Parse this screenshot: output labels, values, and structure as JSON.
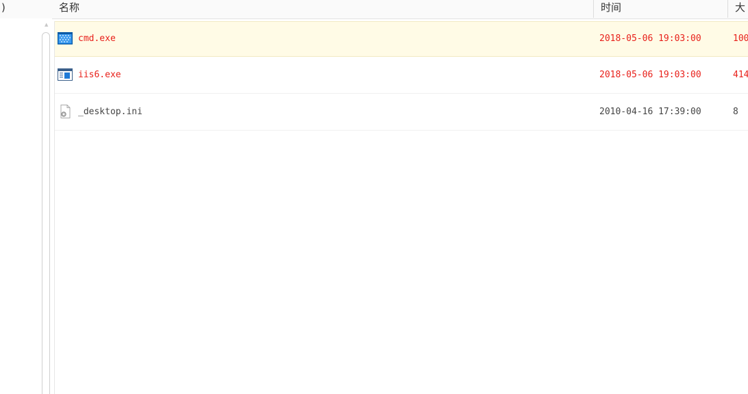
{
  "header": {
    "left_fragment": ")",
    "name_label": "名称",
    "time_label": "时间",
    "size_label_partial": "大"
  },
  "colors": {
    "highlight_text": "#e8201a",
    "normal_text": "#444444",
    "selected_row_bg": "#fffbe6"
  },
  "files": [
    {
      "name": "cmd.exe",
      "time": "2018-05-06 19:03:00",
      "size_partial": "100",
      "icon": "exe-icon",
      "highlighted": true,
      "selected": true
    },
    {
      "name": "iis6.exe",
      "time": "2018-05-06 19:03:00",
      "size_partial": "414",
      "icon": "exe-window-icon",
      "highlighted": true,
      "selected": false
    },
    {
      "name": "_desktop.ini",
      "time": "2010-04-16 17:39:00",
      "size_partial": "8",
      "icon": "settings-file-icon",
      "highlighted": false,
      "selected": false
    }
  ]
}
